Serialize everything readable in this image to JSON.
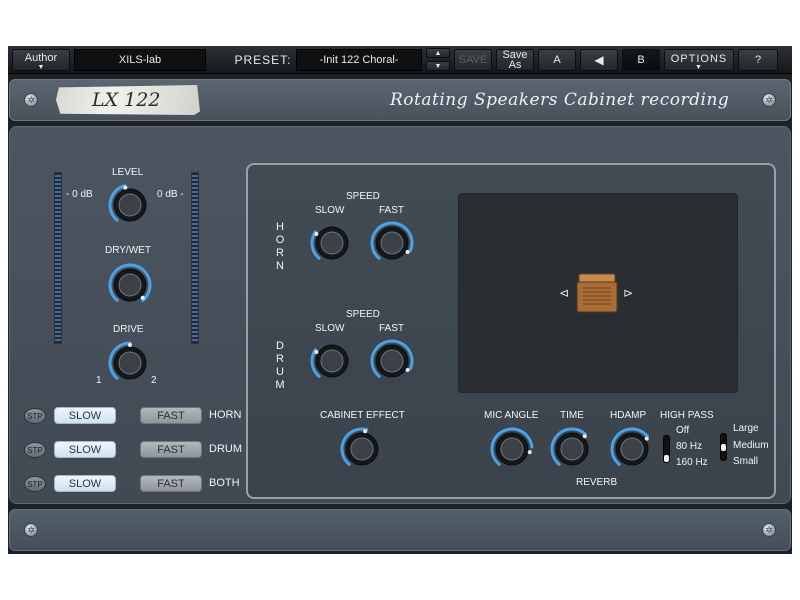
{
  "toolbar": {
    "author_label": "Author",
    "author_value": "XILS-lab",
    "preset_label": "PRESET:",
    "preset_value": "-Init 122 Choral-",
    "save_label": "SAVE",
    "save_as_line1": "Save",
    "save_as_line2": "As",
    "a_label": "A",
    "b_label": "B",
    "options_label": "OPTIONS",
    "help_label": "?"
  },
  "header": {
    "logo": "LX 122",
    "subtitle": "Rotating Speakers Cabinet recording"
  },
  "left": {
    "level_label": "LEVEL",
    "meter_left_label": "- 0 dB",
    "meter_right_label": "0 dB -",
    "drywet_label": "DRY/WET",
    "drive_label": "DRIVE",
    "drive_min": "1",
    "drive_max": "2"
  },
  "speed_rows": [
    {
      "stp": "STP",
      "slow": "SLOW",
      "fast": "FAST",
      "name": "HORN"
    },
    {
      "stp": "STP",
      "slow": "SLOW",
      "fast": "FAST",
      "name": "DRUM"
    },
    {
      "stp": "STP",
      "slow": "SLOW",
      "fast": "FAST",
      "name": "BOTH"
    }
  ],
  "horn": {
    "label": "HORN",
    "speed_label": "SPEED",
    "slow_label": "SLOW",
    "fast_label": "FAST"
  },
  "drum": {
    "label": "DRUM",
    "speed_label": "SPEED",
    "slow_label": "SLOW",
    "fast_label": "FAST"
  },
  "cabinet_effect_label": "CABINET EFFECT",
  "reverb": {
    "mic_angle_label": "MIC ANGLE",
    "time_label": "TIME",
    "hdamp_label": "HDAMP",
    "reverb_label": "REVERB",
    "high_pass_label": "HIGH PASS",
    "high_pass_options": [
      "Off",
      "80 Hz",
      "160 Hz"
    ],
    "high_pass_selected": "160 Hz",
    "size_options": [
      "Large",
      "Medium",
      "Small"
    ],
    "size_selected": "Medium"
  },
  "icons": {
    "screw": "screw-icon",
    "mic": "microphone-icon",
    "cabinet": "speaker-cabinet-icon"
  },
  "colors": {
    "accent": "#4aa3e8",
    "panel": "#48525c"
  }
}
